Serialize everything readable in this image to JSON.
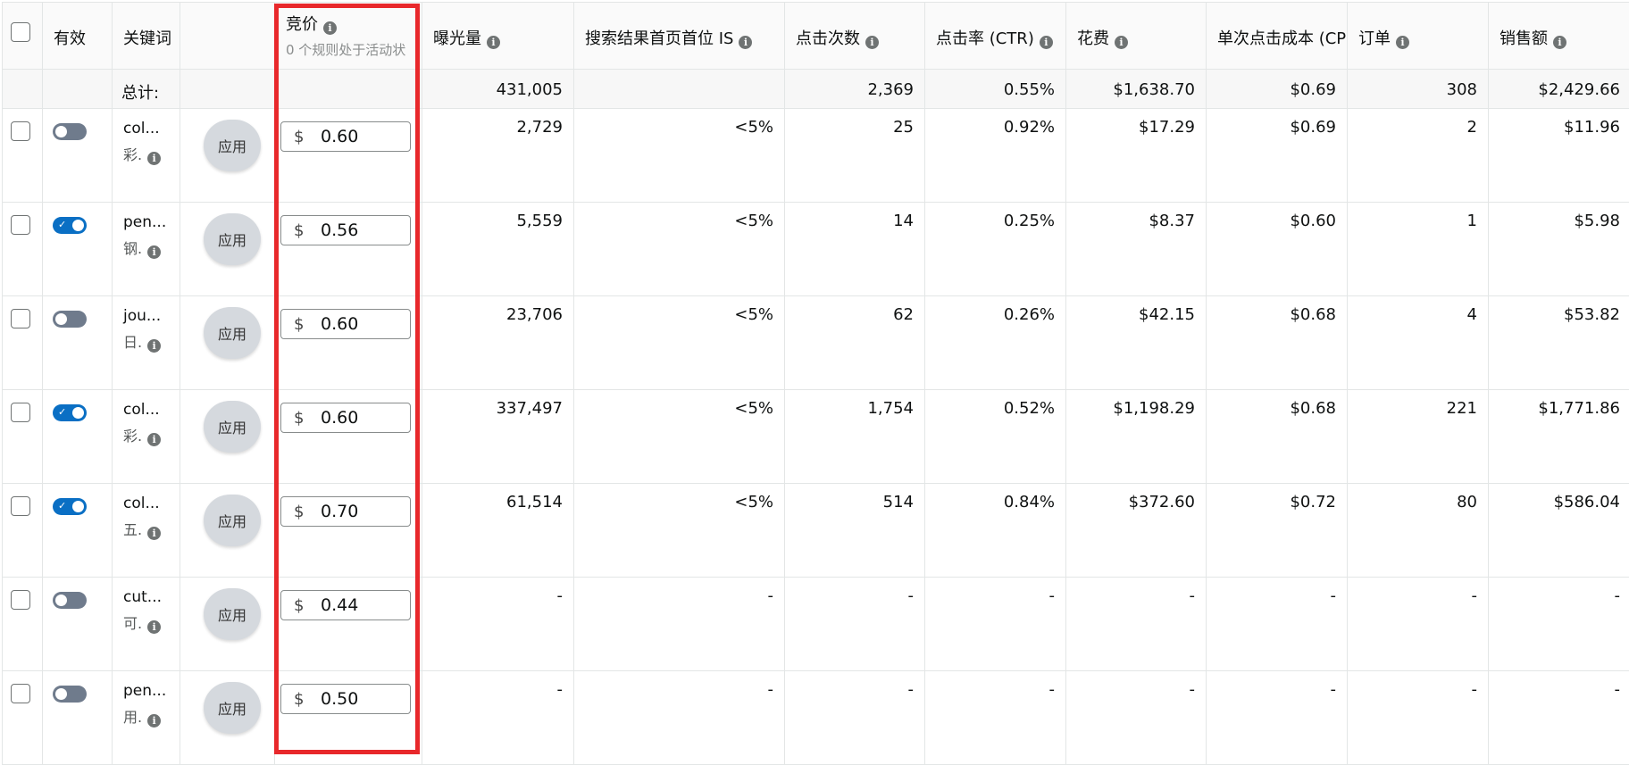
{
  "columns": {
    "active": "有效",
    "keyword": "关键词",
    "bid": "竞价",
    "bid_subtitle": "0 个规则处于活动状",
    "impressions": "曝光量",
    "top_of_search_is": "搜索结果首页首位 IS",
    "clicks": "点击次数",
    "ctr": "点击率 (CTR)",
    "spend": "花费",
    "cpc": "单次点击成本 (CPC)",
    "orders": "订单",
    "sales": "销售额"
  },
  "info_glyph": "i",
  "totals": {
    "label": "总计:",
    "impressions": "431,005",
    "top_is": "",
    "clicks": "2,369",
    "ctr": "0.55%",
    "spend": "$1,638.70",
    "cpc": "$0.69",
    "orders": "308",
    "sales": "$2,429.66"
  },
  "apply_label": "应用",
  "currency": "$",
  "colors": {
    "toggle_on": "#0a6fc4",
    "toggle_off": "#6f7b8c",
    "highlight": "#e8282b"
  },
  "rows": [
    {
      "active": false,
      "kw": "col...",
      "kw2": "彩.",
      "bid": "0.60",
      "impressions": "2,729",
      "top_is": "<5%",
      "clicks": "25",
      "ctr": "0.92%",
      "spend": "$17.29",
      "cpc": "$0.69",
      "orders": "2",
      "sales": "$11.96"
    },
    {
      "active": true,
      "kw": "pen...",
      "kw2": "钢.",
      "bid": "0.56",
      "impressions": "5,559",
      "top_is": "<5%",
      "clicks": "14",
      "ctr": "0.25%",
      "spend": "$8.37",
      "cpc": "$0.60",
      "orders": "1",
      "sales": "$5.98"
    },
    {
      "active": false,
      "kw": "jou...",
      "kw2": "日.",
      "bid": "0.60",
      "impressions": "23,706",
      "top_is": "<5%",
      "clicks": "62",
      "ctr": "0.26%",
      "spend": "$42.15",
      "cpc": "$0.68",
      "orders": "4",
      "sales": "$53.82"
    },
    {
      "active": true,
      "kw": "col...",
      "kw2": "彩.",
      "bid": "0.60",
      "impressions": "337,497",
      "top_is": "<5%",
      "clicks": "1,754",
      "ctr": "0.52%",
      "spend": "$1,198.29",
      "cpc": "$0.68",
      "orders": "221",
      "sales": "$1,771.86"
    },
    {
      "active": true,
      "kw": "col...",
      "kw2": "五.",
      "bid": "0.70",
      "impressions": "61,514",
      "top_is": "<5%",
      "clicks": "514",
      "ctr": "0.84%",
      "spend": "$372.60",
      "cpc": "$0.72",
      "orders": "80",
      "sales": "$586.04"
    },
    {
      "active": false,
      "kw": "cut...",
      "kw2": "可.",
      "bid": "0.44",
      "impressions": "-",
      "top_is": "-",
      "clicks": "-",
      "ctr": "-",
      "spend": "-",
      "cpc": "-",
      "orders": "-",
      "sales": "-"
    },
    {
      "active": false,
      "kw": "pen...",
      "kw2": "用.",
      "bid": "0.50",
      "impressions": "-",
      "top_is": "-",
      "clicks": "-",
      "ctr": "-",
      "spend": "-",
      "cpc": "-",
      "orders": "-",
      "sales": "-"
    }
  ]
}
